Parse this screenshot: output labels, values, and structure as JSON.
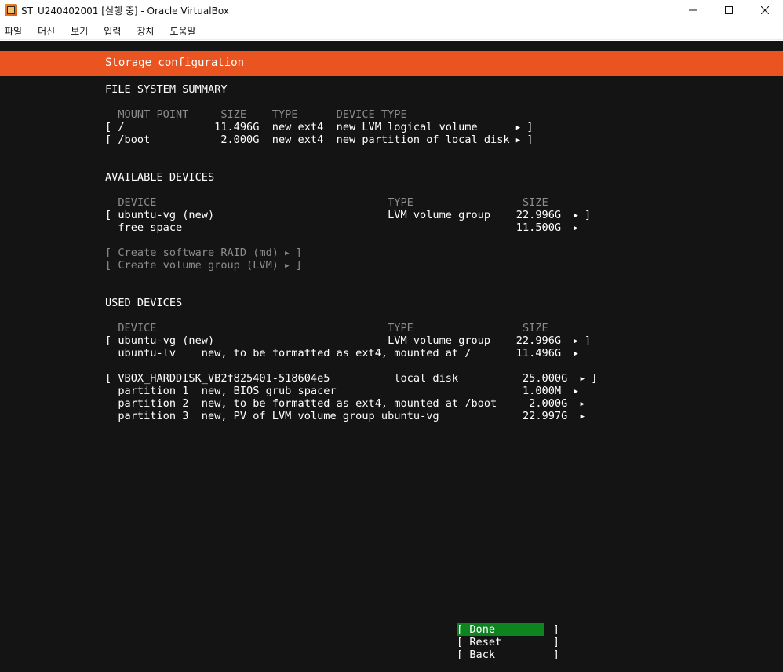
{
  "window": {
    "title": "ST_U240402001 [실행 중] - Oracle VirtualBox",
    "icon": "virtualbox-icon"
  },
  "menu": [
    "파일",
    "머신",
    "보기",
    "입력",
    "장치",
    "도움말"
  ],
  "installer": {
    "header_title": "Storage configuration",
    "accent_color": "#e95420",
    "done_color": "#0e8420",
    "fs_summary": {
      "title": "FILE SYSTEM SUMMARY",
      "header": "  MOUNT POINT     SIZE    TYPE      DEVICE TYPE",
      "rows": [
        "[ /              11.496G  new ext4  new LVM logical volume      ",
        "[ /boot           2.000G  new ext4  new partition of local disk "
      ]
    },
    "available": {
      "title": "AVAILABLE DEVICES",
      "header": "  DEVICE                                    TYPE                 SIZE",
      "rows": [
        "[ ubuntu-vg (new)                           LVM volume group    22.996G  ",
        "  free space                                                    11.500G  "
      ],
      "actions": [
        "[ Create software RAID (md) ",
        "[ Create volume group (LVM) "
      ]
    },
    "used": {
      "title": "USED DEVICES",
      "header": "  DEVICE                                    TYPE                 SIZE",
      "rows": [
        "[ ubuntu-vg (new)                           LVM volume group    22.996G  ",
        "  ubuntu-lv    new, to be formatted as ext4, mounted at /       11.496G  ",
        "[ VBOX_HARDDISK_VB2f825401-518604e5          local disk          25.000G  ",
        "  partition 1  new, BIOS grub spacer                             1.000M  ",
        "  partition 2  new, to be formatted as ext4, mounted at /boot     2.000G  ",
        "  partition 3  new, PV of LVM volume group ubuntu-vg             22.997G  "
      ]
    },
    "buttons": {
      "done": "[ Done         ]",
      "reset": "[ Reset        ]",
      "back": "[ Back         ]"
    }
  }
}
